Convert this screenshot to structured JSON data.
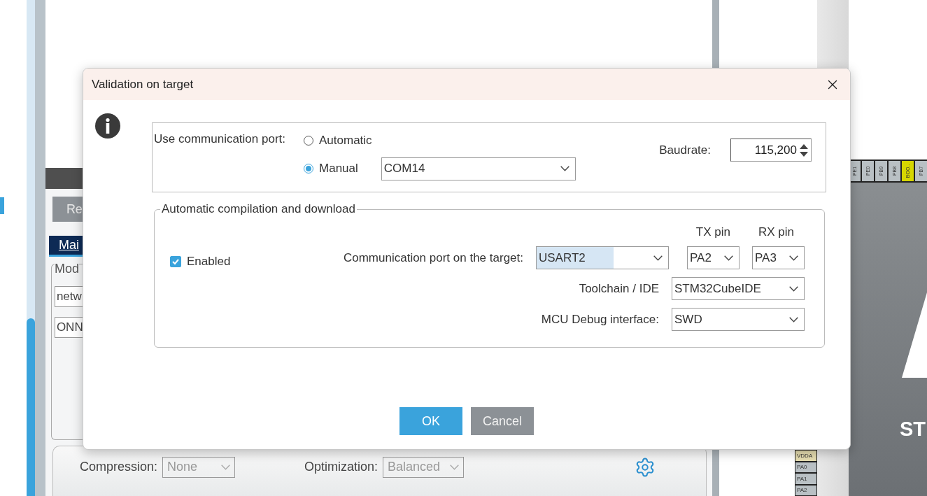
{
  "background": {
    "left_panel": {
      "button": "Re",
      "tab": {
        "label": "Mai",
        "selected": true
      },
      "group_title": "Mod",
      "fields": [
        "netw",
        "ONN"
      ]
    },
    "settings": {
      "compression_label": "Compression:",
      "compression": "None",
      "optimization_label": "Optimization:",
      "optimization": "Balanced"
    },
    "chip": {
      "top_pins": [
        {
          "label": "PE1",
          "color": "#b9c0c4"
        },
        {
          "label": "PE0",
          "color": "#b9c0c4"
        },
        {
          "label": "PB9",
          "color": "#b9c0c4"
        },
        {
          "label": "PB8",
          "color": "#b9c0c4"
        },
        {
          "label": "BOO..",
          "color": "#d6d600"
        },
        {
          "label": "PB7",
          "color": "#b9c0c4"
        }
      ],
      "left_pins": [
        {
          "label": "VDDA",
          "color": "#e6ddb0"
        },
        {
          "label": "PA0",
          "color": "#b9c0c4"
        },
        {
          "label": "PA1",
          "color": "#b9c0c4"
        },
        {
          "label": "PA2",
          "color": "#b9c0c4"
        }
      ],
      "logo": "ST"
    }
  },
  "dialog": {
    "title": "Validation on target",
    "port": {
      "label": "Use communication port:",
      "options": [
        {
          "label": "Automatic",
          "selected": false
        },
        {
          "label": "Manual",
          "selected": true
        }
      ],
      "port_value": "COM14",
      "baudrate_label": "Baudrate:",
      "baudrate": "115,200"
    },
    "compilation": {
      "legend": "Automatic compilation and download",
      "enabled": {
        "label": "Enabled",
        "checked": true
      },
      "target_label": "Communication port on the target:",
      "target_value": "USART2",
      "target_highlighted": true,
      "tx_label": "TX pin",
      "tx_value": "PA2",
      "rx_label": "RX pin",
      "rx_value": "PA3",
      "toolchain_label": "Toolchain / IDE",
      "toolchain_value": "STM32CubeIDE",
      "debug_label": "MCU Debug interface:",
      "debug_value": "SWD"
    },
    "buttons": [
      {
        "label": "OK",
        "kind": "primary"
      },
      {
        "label": "Cancel",
        "kind": "secondary"
      }
    ]
  }
}
